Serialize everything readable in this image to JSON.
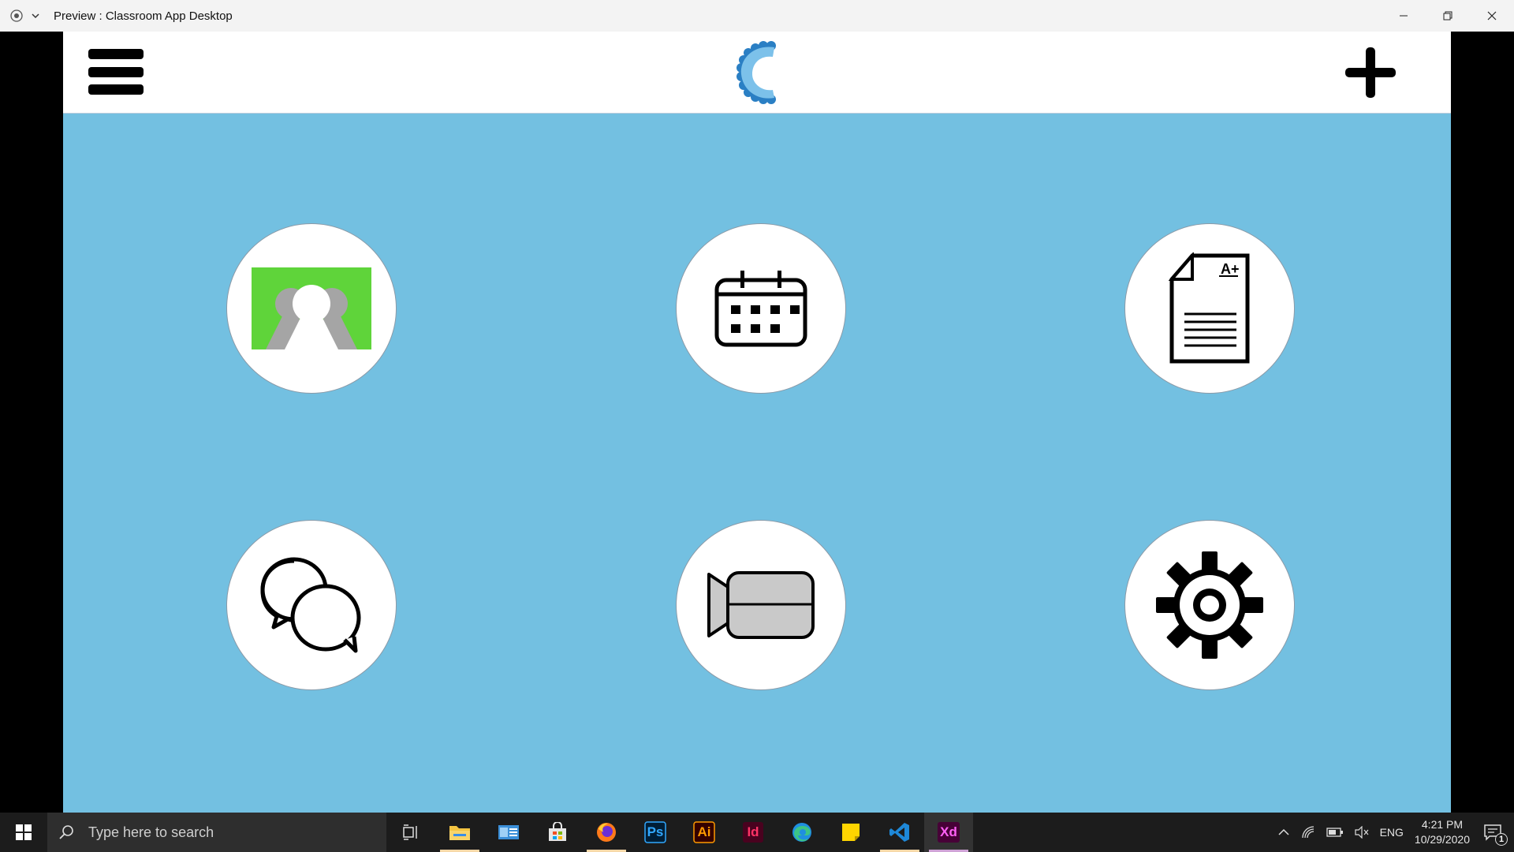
{
  "window": {
    "title": "Preview : Classroom App Desktop"
  },
  "header": {
    "menu_icon": "hamburger-menu-icon",
    "logo_icon": "classroom-c-logo",
    "add_icon": "plus-icon"
  },
  "tiles": [
    {
      "name": "contacts",
      "icon": "contacts-people-icon"
    },
    {
      "name": "calendar",
      "icon": "calendar-icon"
    },
    {
      "name": "grades",
      "icon": "graded-document-icon",
      "grade_text": "A+"
    },
    {
      "name": "chat",
      "icon": "chat-bubbles-icon"
    },
    {
      "name": "video",
      "icon": "video-camera-icon"
    },
    {
      "name": "settings",
      "icon": "gear-icon"
    }
  ],
  "taskbar": {
    "search_placeholder": "Type here to search",
    "apps": [
      {
        "name": "task-view",
        "icon": "task-view-icon"
      },
      {
        "name": "file-explorer",
        "icon": "folder-icon"
      },
      {
        "name": "outlook",
        "icon": "mail-icon"
      },
      {
        "name": "store",
        "icon": "store-bag-icon"
      },
      {
        "name": "firefox",
        "icon": "firefox-icon"
      },
      {
        "name": "photoshop",
        "label": "Ps"
      },
      {
        "name": "illustrator",
        "label": "Ai"
      },
      {
        "name": "indesign",
        "label": "Id"
      },
      {
        "name": "edge",
        "icon": "edge-icon"
      },
      {
        "name": "sticky-notes",
        "icon": "sticky-note-icon"
      },
      {
        "name": "vscode",
        "icon": "vscode-icon"
      },
      {
        "name": "xd",
        "label": "Xd"
      }
    ],
    "tray": {
      "language": "ENG",
      "time": "4:21 PM",
      "date": "10/29/2020",
      "notification_count": "1"
    }
  },
  "colors": {
    "app_background": "#73c0e1",
    "header_background": "#ffffff",
    "contacts_green": "#5fd43a",
    "logo_blue": "#2a7fc4"
  }
}
